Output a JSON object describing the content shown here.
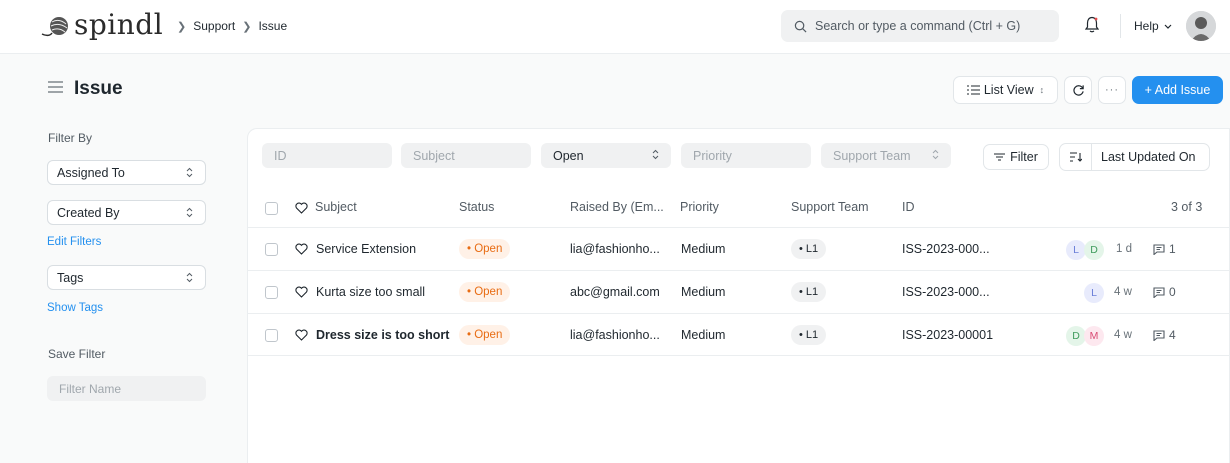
{
  "navbar": {
    "brand": "spindl",
    "breadcrumbs": [
      "Support",
      "Issue"
    ],
    "search_placeholder": "Search or type a command (Ctrl + G)",
    "help_label": "Help"
  },
  "page": {
    "title": "Issue",
    "list_view_label": "List View",
    "more_label": "···",
    "add_label": "+ Add Issue"
  },
  "sidebar": {
    "filter_by": "Filter By",
    "assigned_to": "Assigned To",
    "created_by": "Created By",
    "edit_filters": "Edit Filters",
    "tags": "Tags",
    "show_tags": "Show Tags",
    "save_filter": "Save Filter",
    "filter_name_placeholder": "Filter Name"
  },
  "filters": {
    "id_placeholder": "ID",
    "subject_placeholder": "Subject",
    "status_value": "Open",
    "priority_placeholder": "Priority",
    "team_placeholder": "Support Team",
    "filter_label": "Filter",
    "sort_label": "Last Updated On"
  },
  "table": {
    "headers": {
      "subject": "Subject",
      "status": "Status",
      "raised_by": "Raised By (Em...",
      "priority": "Priority",
      "team": "Support Team",
      "id": "ID",
      "count": "3 of 3"
    },
    "rows": [
      {
        "subject": "Service Extension",
        "status": "• Open",
        "raised_by": "lia@fashionho...",
        "priority": "Medium",
        "team": "• L1",
        "id": "ISS-2023-000...",
        "assignees": [
          "L",
          "D"
        ],
        "age": "1 d",
        "comments": "1"
      },
      {
        "subject": "Kurta size too small",
        "status": "• Open",
        "raised_by": "abc@gmail.com",
        "priority": "Medium",
        "team": "• L1",
        "id": "ISS-2023-000...",
        "assignees": [
          "L"
        ],
        "age": "4 w",
        "comments": "0"
      },
      {
        "subject": "Dress size is too short",
        "status": "• Open",
        "raised_by": "lia@fashionho...",
        "priority": "Medium",
        "team": "• L1",
        "id": "ISS-2023-00001",
        "assignees": [
          "D",
          "M"
        ],
        "age": "4 w",
        "comments": "4"
      }
    ]
  },
  "colors": {
    "primary": "#2490ef",
    "status_open": "#e86c13",
    "status_open_bg": "#fff1e7"
  }
}
